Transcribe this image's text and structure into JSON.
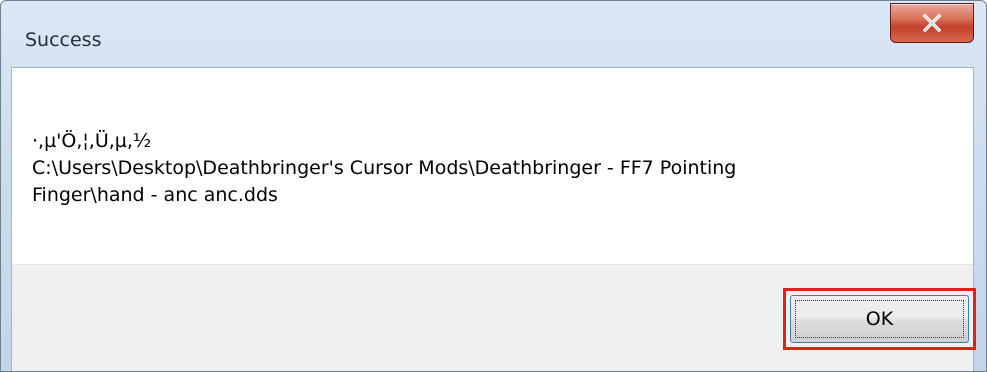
{
  "dialog": {
    "title": "Success",
    "message_line1": "·,µ'Ö,¦,Ü,µ,½",
    "message_line2": "C:\\Users\\Desktop\\Deathbringer's Cursor Mods\\Deathbringer - FF7 Pointing",
    "message_line3": "Finger\\hand - anc anc.dds",
    "ok_label": "OK",
    "close_icon": "close-x-icon",
    "highlight_color": "#e0201a",
    "close_button_color": "#c4402a"
  }
}
